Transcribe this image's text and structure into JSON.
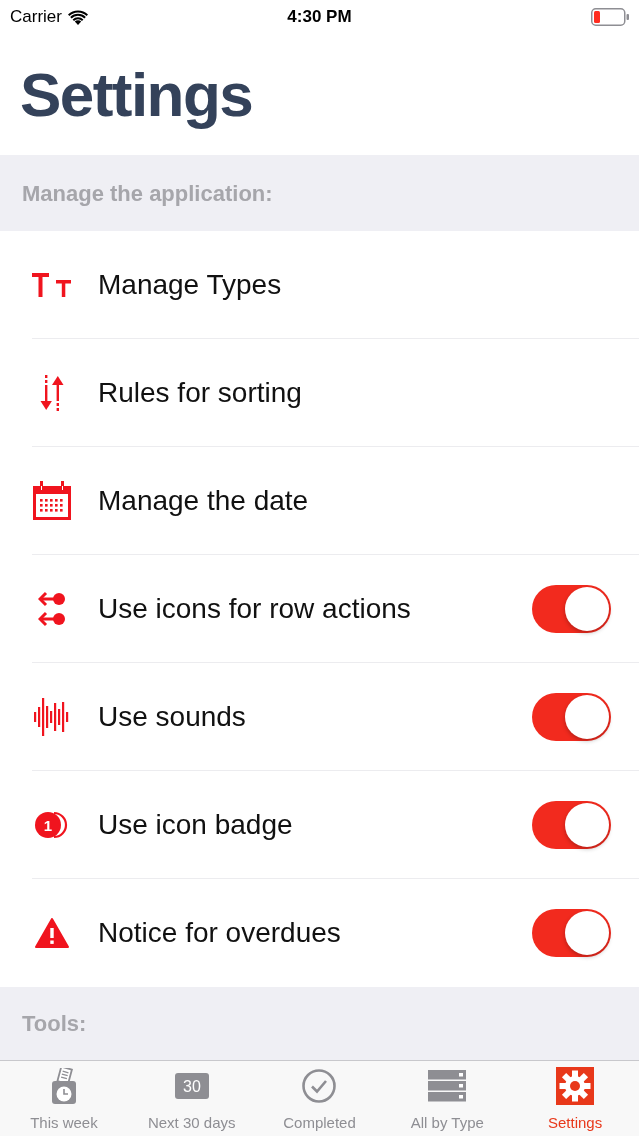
{
  "status_bar": {
    "carrier": "Carrier",
    "time": "4:30 PM"
  },
  "title": "Settings",
  "sections": [
    {
      "header": "Manage the application:",
      "rows": [
        {
          "kind": "link",
          "label": "Manage Types"
        },
        {
          "kind": "link",
          "label": "Rules for sorting"
        },
        {
          "kind": "link",
          "label": "Manage the date"
        },
        {
          "kind": "toggle",
          "label": "Use icons for row actions",
          "on": true
        },
        {
          "kind": "toggle",
          "label": "Use sounds",
          "on": true
        },
        {
          "kind": "toggle",
          "label": "Use icon badge",
          "on": true,
          "icon_text": "1"
        },
        {
          "kind": "toggle",
          "label": "Notice for overdues",
          "on": true
        }
      ]
    },
    {
      "header": "Tools:"
    }
  ],
  "tab_bar": [
    {
      "label": "This week",
      "selected": false
    },
    {
      "label": "Next 30 days",
      "icon_text": "30",
      "selected": false
    },
    {
      "label": "Completed",
      "selected": false
    },
    {
      "label": "All by Type",
      "selected": false
    },
    {
      "label": "Settings",
      "selected": true
    }
  ]
}
